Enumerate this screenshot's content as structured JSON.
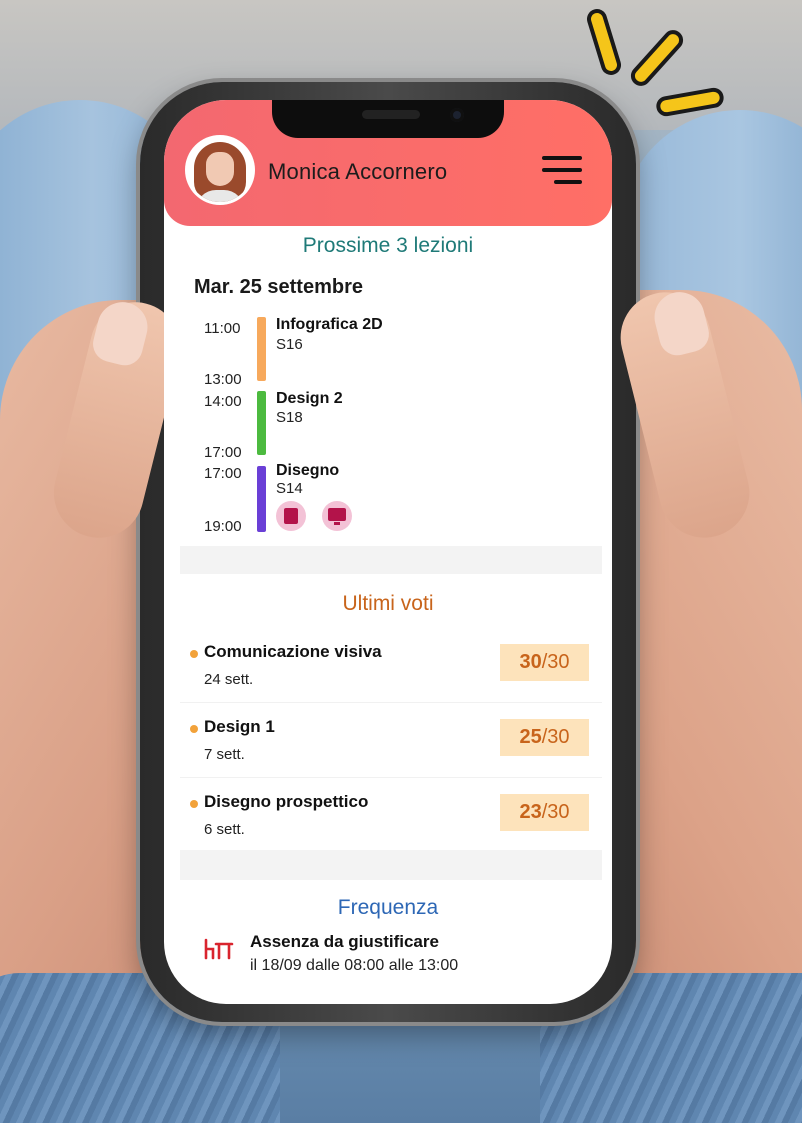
{
  "header": {
    "user_name": "Monica Accornero"
  },
  "lessons_section": {
    "title": "Prossime 3 lezioni",
    "date": "Mar. 25 settembre",
    "lessons": [
      {
        "start": "11:00",
        "end": "13:00",
        "title": "Infografica 2D",
        "room": "S16",
        "color": "#f7a95c"
      },
      {
        "start": "14:00",
        "end": "17:00",
        "title": "Design 2",
        "room": "S18",
        "color": "#4cba3f"
      },
      {
        "start": "17:00",
        "end": "19:00",
        "title": "Disegno",
        "room": "S14",
        "color": "#6a3fd6",
        "icons": [
          "book-icon",
          "presentation-screen-icon"
        ]
      }
    ]
  },
  "grades_section": {
    "title": "Ultimi voti",
    "grades": [
      {
        "subject": "Comunicazione visiva",
        "date": "24 sett.",
        "value": "30",
        "max": "/30"
      },
      {
        "subject": "Design 1",
        "date": "7 sett.",
        "value": "25",
        "max": "/30"
      },
      {
        "subject": "Disegno prospettico",
        "date": "6 sett.",
        "value": "23",
        "max": "/30"
      }
    ]
  },
  "attendance_section": {
    "title": "Frequenza",
    "absence_title": "Assenza da giustificare",
    "absence_detail": "il 18/09 dalle 08:00 alle 13:00"
  },
  "colors": {
    "header": "#f36870",
    "lessons_title": "#1f7a78",
    "grades_title": "#c8641b",
    "attendance_title": "#2d67b5",
    "grade_box": "#fde3bb",
    "absence_icon": "#d9242e"
  }
}
